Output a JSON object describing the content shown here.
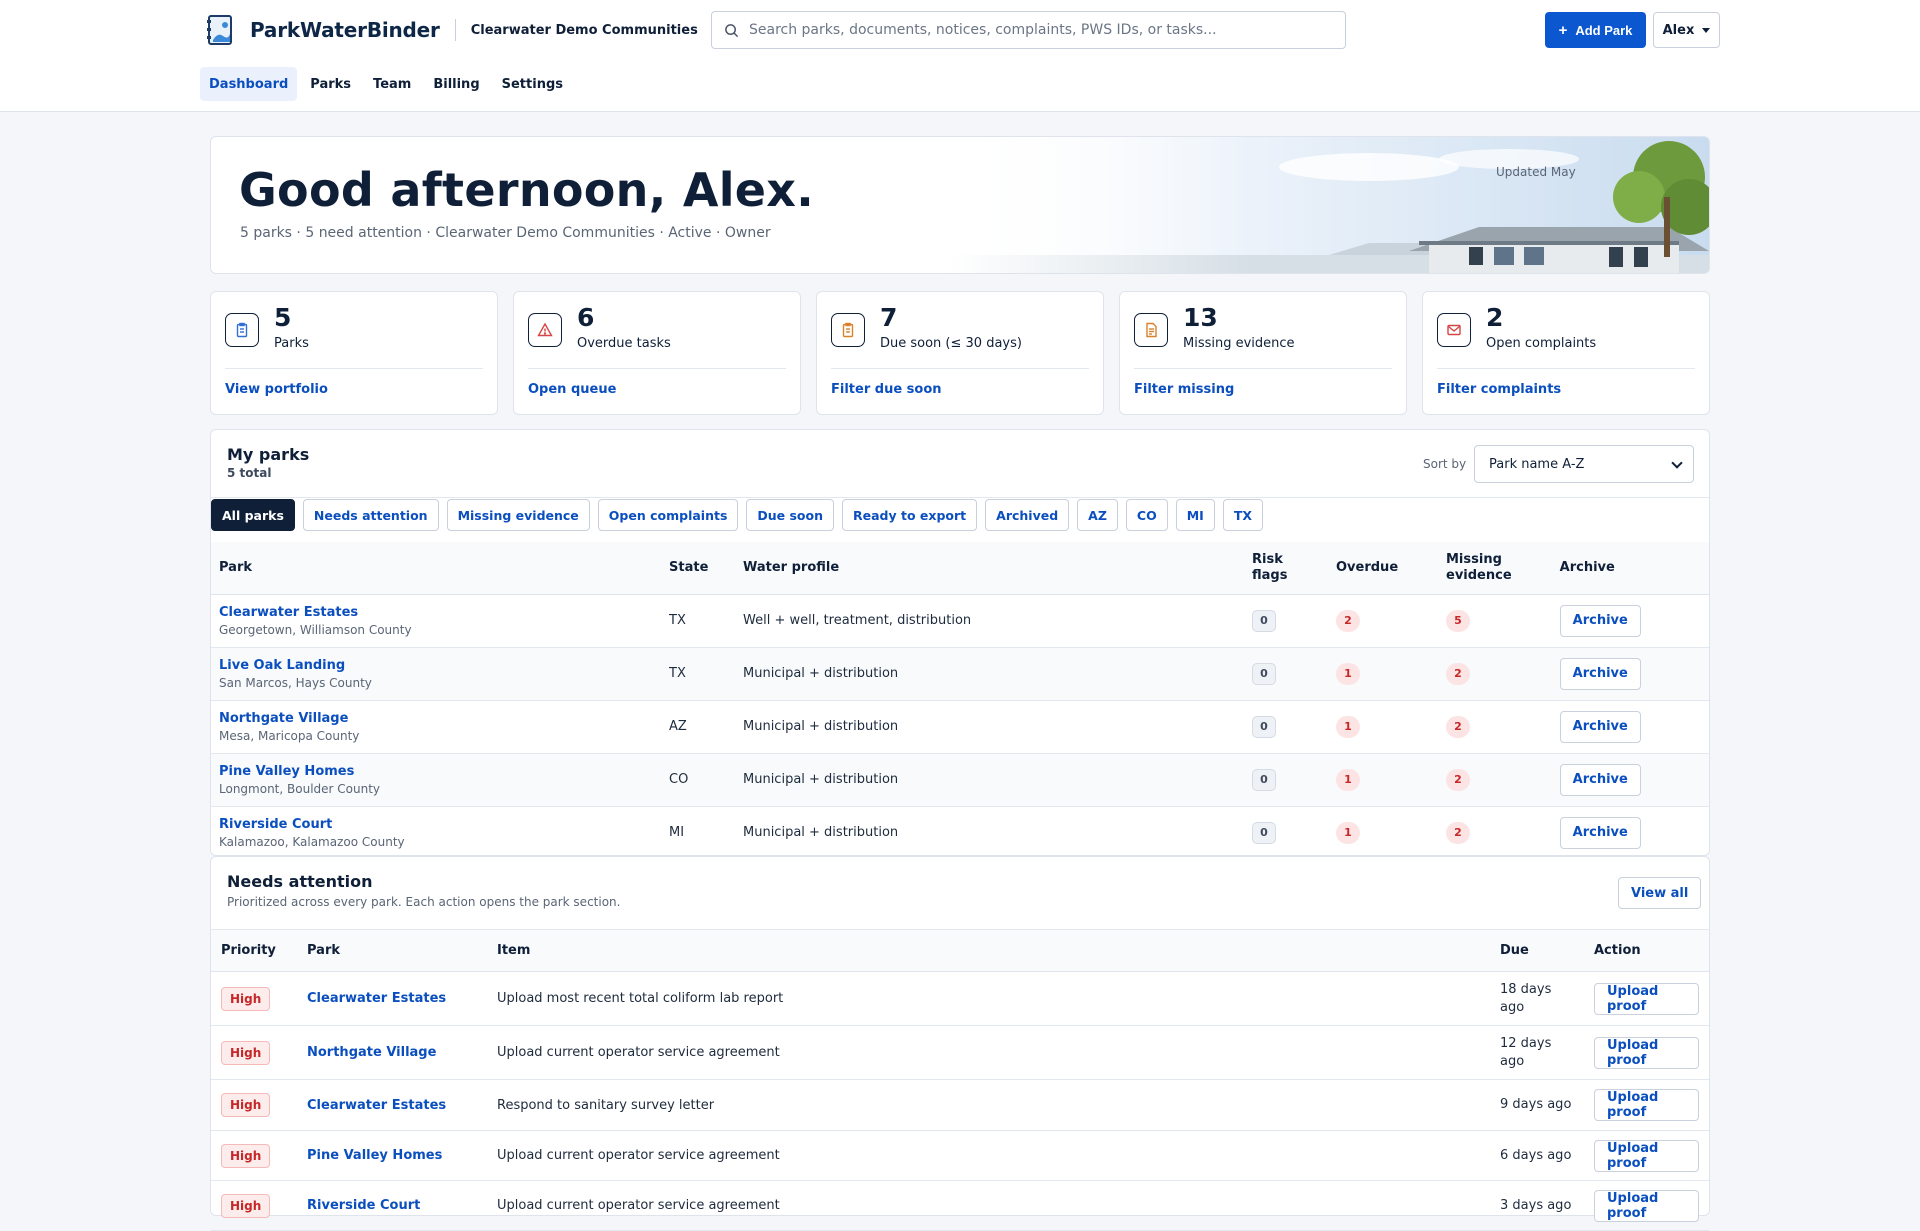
{
  "app": {
    "name": "ParkWaterBinder",
    "org": "Clearwater Demo Communities"
  },
  "search": {
    "placeholder": "Search parks, documents, notices, complaints, PWS IDs, or tasks..."
  },
  "header": {
    "add_label": "Add Park",
    "user_label": "Alex"
  },
  "nav": [
    {
      "label": "Dashboard",
      "active": true
    },
    {
      "label": "Parks"
    },
    {
      "label": "Team"
    },
    {
      "label": "Billing"
    },
    {
      "label": "Settings"
    }
  ],
  "hero": {
    "greeting": "Good afternoon, Alex.",
    "summary": "5 parks · 5 need attention · Clearwater Demo Communities · Active · Owner",
    "updated": "Updated May"
  },
  "stats": [
    {
      "value": "5",
      "label": "Parks",
      "link": "View portfolio",
      "icon": "clipboard-icon",
      "color": "#2f6fd6"
    },
    {
      "value": "6",
      "label": "Overdue tasks",
      "link": "Open queue",
      "icon": "warning-icon",
      "color": "#d64545"
    },
    {
      "value": "7",
      "label": "Due soon (≤ 30 days)",
      "link": "Filter due soon",
      "icon": "clipboard-icon",
      "color": "#d9822b"
    },
    {
      "value": "13",
      "label": "Missing evidence",
      "link": "Filter missing",
      "icon": "document-icon",
      "color": "#d9822b"
    },
    {
      "value": "2",
      "label": "Open complaints",
      "link": "Filter complaints",
      "icon": "mail-icon",
      "color": "#d64545"
    }
  ],
  "parks": {
    "title": "My parks",
    "total": "5 total",
    "sort_label": "Sort by",
    "sort_value": "Park name A-Z",
    "chips": [
      "All parks",
      "Needs attention",
      "Missing evidence",
      "Open complaints",
      "Due soon",
      "Ready to export",
      "Archived",
      "AZ",
      "CO",
      "MI",
      "TX"
    ],
    "columns": [
      "Park",
      "State",
      "Water profile",
      "Risk flags",
      "Overdue",
      "Missing evidence",
      "Archive"
    ],
    "rows": [
      {
        "name": "Clearwater Estates",
        "location": "Georgetown, Williamson County",
        "state": "TX",
        "profile": "Well + well, treatment, distribution",
        "risk": "0",
        "overdue": "2",
        "missing": "5",
        "action": "Archive"
      },
      {
        "name": "Live Oak Landing",
        "location": "San Marcos, Hays County",
        "state": "TX",
        "profile": "Municipal + distribution",
        "risk": "0",
        "overdue": "1",
        "missing": "2",
        "action": "Archive"
      },
      {
        "name": "Northgate Village",
        "location": "Mesa, Maricopa County",
        "state": "AZ",
        "profile": "Municipal + distribution",
        "risk": "0",
        "overdue": "1",
        "missing": "2",
        "action": "Archive"
      },
      {
        "name": "Pine Valley Homes",
        "location": "Longmont, Boulder County",
        "state": "CO",
        "profile": "Municipal + distribution",
        "risk": "0",
        "overdue": "1",
        "missing": "2",
        "action": "Archive"
      },
      {
        "name": "Riverside Court",
        "location": "Kalamazoo, Kalamazoo County",
        "state": "MI",
        "profile": "Municipal + distribution",
        "risk": "0",
        "overdue": "1",
        "missing": "2",
        "action": "Archive"
      }
    ]
  },
  "attention": {
    "title": "Needs attention",
    "subtitle": "Prioritized across every park. Each action opens the park section.",
    "view_all": "View all",
    "columns": [
      "Priority",
      "Park",
      "Item",
      "Due",
      "Action"
    ],
    "rows": [
      {
        "priority": "High",
        "park": "Clearwater Estates",
        "item": "Upload most recent total coliform lab report",
        "due": "18 days ago",
        "action": "Upload proof"
      },
      {
        "priority": "High",
        "park": "Northgate Village",
        "item": "Upload current operator service agreement",
        "due": "12 days ago",
        "action": "Upload proof"
      },
      {
        "priority": "High",
        "park": "Clearwater Estates",
        "item": "Respond to sanitary survey letter",
        "due": "9 days ago",
        "action": "Upload proof"
      },
      {
        "priority": "High",
        "park": "Pine Valley Homes",
        "item": "Upload current operator service agreement",
        "due": "6 days ago",
        "action": "Upload proof"
      },
      {
        "priority": "High",
        "park": "Riverside Court",
        "item": "Upload current operator service agreement",
        "due": "3 days ago",
        "action": "Upload proof"
      }
    ]
  }
}
